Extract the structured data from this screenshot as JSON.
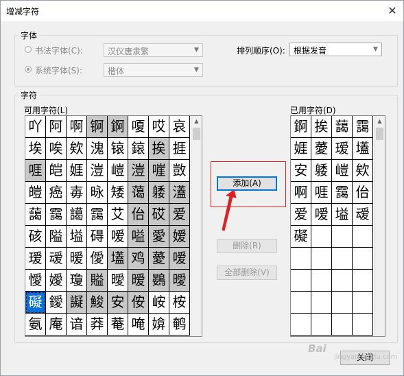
{
  "window": {
    "title": "增减字符",
    "close_glyph": "✕"
  },
  "font_group": {
    "label": "字体",
    "calligraphy_radio": "书法字体(C):",
    "calligraphy_font": "汉仪唐隶繁",
    "system_radio": "系统字体(S):",
    "system_font": "楷体",
    "sort_label": "排列顺序(O):",
    "sort_value": "根据发音"
  },
  "char_group": {
    "label": "字符",
    "available_label": "可用字符(L)",
    "used_label": "已用字符(D)",
    "available_chars": [
      "吖",
      "阿",
      "啊",
      "锕",
      "錒",
      "嗄",
      "哎",
      "哀",
      "埃",
      "唉",
      "欸",
      "溾",
      "锿",
      "鎄",
      "挨",
      "捱",
      "啀",
      "皑",
      "娾",
      "溰",
      "嵦",
      "溰",
      "嘊",
      "敳",
      "皚",
      "癌",
      "毐",
      "昹",
      "矮",
      "蔼",
      "躷",
      "濭",
      "藹",
      "靄",
      "譪",
      "靄",
      "艾",
      "佁",
      "砹",
      "爱",
      "硋",
      "隘",
      "塧",
      "碍",
      "嗳",
      "嗌",
      "愛",
      "嫒",
      "瑷",
      "叆",
      "暧",
      "僾",
      "壒",
      "鸡",
      "薆",
      "嗳",
      "懓",
      "嬡",
      "瓊",
      "賹",
      "曖",
      "暧",
      "鷃",
      "曖",
      "礙",
      "鑀",
      "譺",
      "鮻",
      "安",
      "侒",
      "峖",
      "桉",
      "氨",
      "庵",
      "谙",
      "莽",
      "菴",
      "唵",
      "媕",
      "鹌"
    ],
    "available_highlight": [
      3,
      4,
      14,
      16,
      21,
      22,
      29,
      30,
      31,
      37,
      38,
      39,
      45,
      46,
      47,
      52,
      53,
      54,
      55,
      59,
      61,
      62,
      63,
      66,
      67,
      68,
      69
    ],
    "available_selected": 64,
    "used_chars": [
      "錒",
      "挨",
      "藹",
      "靄",
      "娾",
      "薆",
      "瑷",
      "壒",
      "安",
      "躷",
      "嵦",
      "欸",
      "啊",
      "啀",
      "靄",
      "佁",
      "爱",
      "嗳",
      "塧",
      "叆",
      "礙"
    ]
  },
  "buttons": {
    "add": "添加(A)",
    "remove": "删除(R)",
    "remove_all": "全部删除(V)",
    "close": "关闭"
  },
  "colors": {
    "selection": "#0a6fd8",
    "highlight": "#c8c8c8",
    "annotation": "#e02020",
    "default_border": "#0078d7"
  },
  "overlay": {
    "watermark": "Bai",
    "watermark_sub": "jingyan.baidu.com"
  }
}
